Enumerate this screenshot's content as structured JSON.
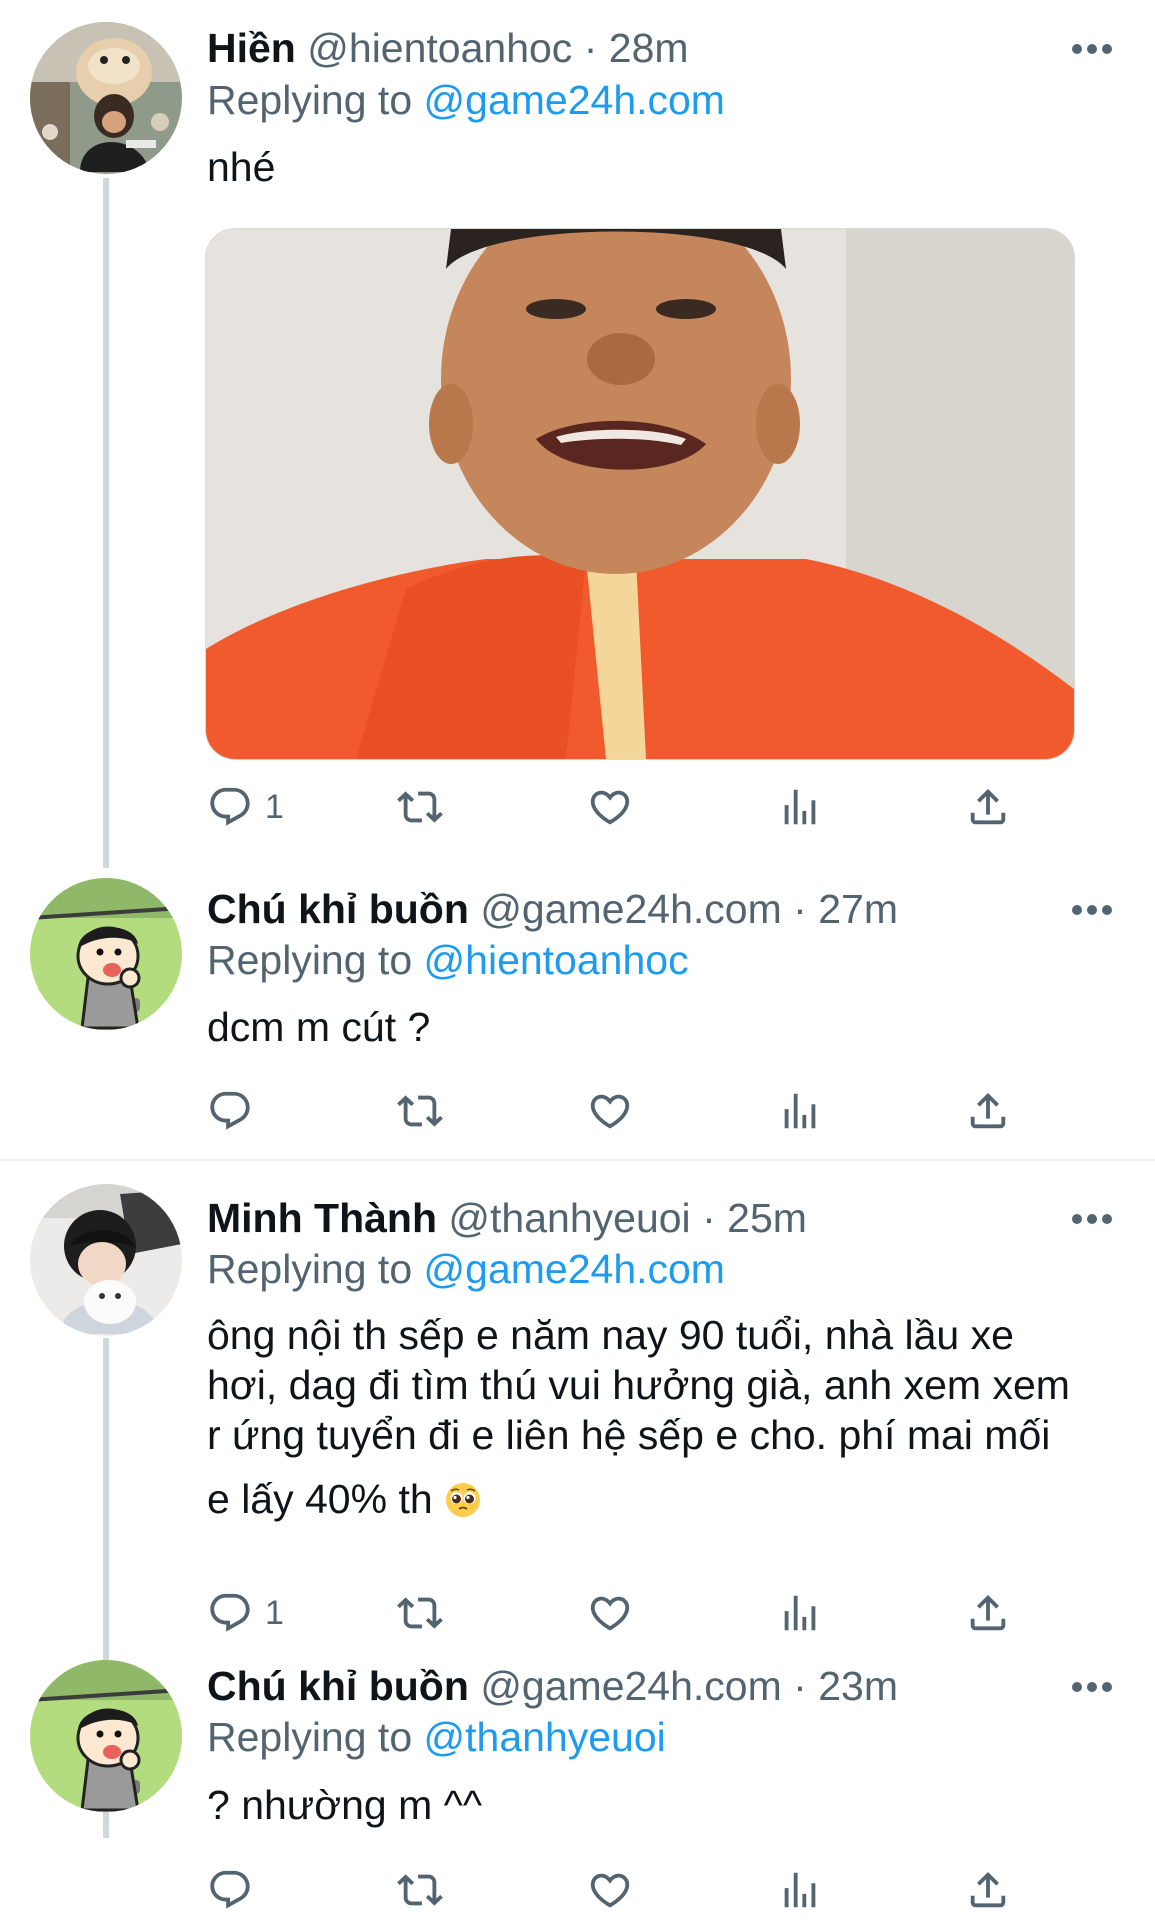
{
  "tweets": [
    {
      "name": "Hiền",
      "handle": "@hientoanhoc",
      "dot": "·",
      "time": "28m",
      "replying_prefix": "Replying to",
      "replying_to": "@game24h.com",
      "text": "nhé",
      "reply_count": "1"
    },
    {
      "name": "Chú khỉ buồn",
      "handle": "@game24h.com",
      "dot": "·",
      "time": "27m",
      "replying_prefix": "Replying to",
      "replying_to": "@hientoanhoc",
      "text": "dcm m cút ?",
      "reply_count": ""
    },
    {
      "name": "Minh Thành",
      "handle": "@thanhyeuoi",
      "dot": "·",
      "time": "25m",
      "replying_prefix": "Replying to",
      "replying_to": "@game24h.com",
      "text_lines": [
        "ông nội th sếp e năm nay 90 tuổi, nhà lầu xe",
        "hơi, dag đi tìm thú vui hưởng già, anh xem xem",
        "r ứng tuyển đi e liên hệ sếp e cho. phí mai mối",
        "e lấy 40% th"
      ],
      "emoji": "pleading-face-emoji",
      "reply_count": "1"
    },
    {
      "name": "Chú khỉ buồn",
      "handle": "@game24h.com",
      "dot": "·",
      "time": "23m",
      "replying_prefix": "Replying to",
      "replying_to": "@thanhyeuoi",
      "text": "? nhường m ^^",
      "reply_count": ""
    }
  ],
  "colors": {
    "link": "#1d9bf0",
    "secondary": "#536471",
    "primary_text": "#0f1419",
    "thread_line": "#cfd9de"
  },
  "icons": [
    "reply-icon",
    "retweet-icon",
    "like-icon",
    "analytics-icon",
    "share-icon",
    "more-icon"
  ]
}
